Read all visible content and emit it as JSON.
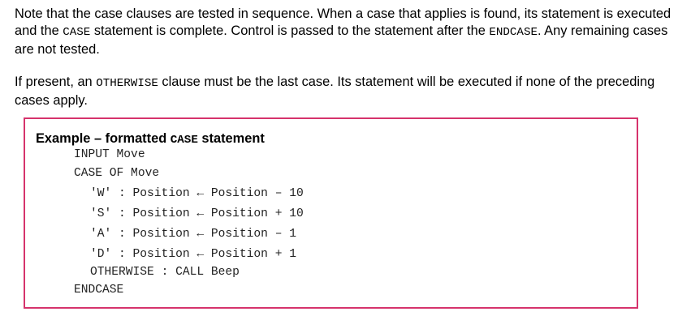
{
  "para1": {
    "t1": "Note that the case clauses are tested in sequence. When a case that applies is found, its statement is executed and the ",
    "c1": "CASE",
    "t2": " statement is complete.  Control is passed to the statement after the ",
    "c2": "ENDCASE",
    "t3": ". Any remaining cases are not tested."
  },
  "para2": {
    "t1": "If present, an ",
    "c1": "OTHERWISE",
    "t2": " clause must be the last case. Its statement will be executed if none of the preceding cases apply."
  },
  "example": {
    "title_prefix": "Example – formatted ",
    "title_code": "CASE",
    "title_suffix": " statement",
    "lines": [
      "INPUT Move",
      "CASE OF Move",
      "'W' : Position ← Position – 10",
      "'S' : Position ← Position + 10",
      "'A' : Position ← Position – 1",
      "'D' : Position ← Position + 1",
      "OTHERWISE : CALL Beep",
      "ENDCASE"
    ]
  },
  "colors": {
    "box_border": "#d6336c"
  }
}
